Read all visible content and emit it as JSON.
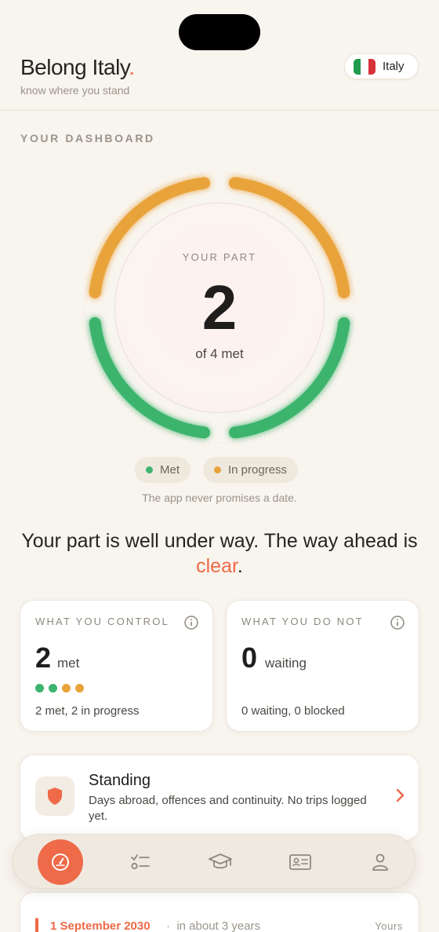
{
  "header": {
    "title": "Belong Italy",
    "title_dot": ".",
    "tagline": "know where you stand",
    "country": "Italy"
  },
  "dashboard": {
    "section_label": "YOUR DASHBOARD",
    "dial_caption": "YOUR PART",
    "met_count": "2",
    "met_of": "of 4 met",
    "segments": [
      {
        "status": "in_progress"
      },
      {
        "status": "in_progress"
      },
      {
        "status": "met"
      },
      {
        "status": "met"
      }
    ],
    "legend": [
      {
        "label": "Met",
        "color": "#3db46d"
      },
      {
        "label": "In progress",
        "color": "#e9a33b"
      }
    ],
    "disclaimer": "The app never promises a date.",
    "headline_main": "Your part is well under way. The way ahead is ",
    "headline_accent": "clear",
    "headline_end": "."
  },
  "control_card": {
    "label": "WHAT YOU CONTROL",
    "value": "2",
    "unit": "met",
    "dots": [
      "#3db46d",
      "#3db46d",
      "#e9a33b",
      "#e9a33b"
    ],
    "footer": "2 met, 2 in progress"
  },
  "notcontrol_card": {
    "label": "WHAT YOU DO NOT",
    "value": "0",
    "unit": "waiting",
    "footer": "0 waiting, 0 blocked"
  },
  "standing": {
    "title": "Standing",
    "description": "Days abroad, offences and continuity. No trips logged yet."
  },
  "tabs": [
    {
      "name": "dashboard",
      "icon": "gauge-icon",
      "active": true
    },
    {
      "name": "checklist",
      "icon": "checklist-icon",
      "active": false
    },
    {
      "name": "learn",
      "icon": "graduation-cap-icon",
      "active": false
    },
    {
      "name": "documents",
      "icon": "id-card-icon",
      "active": false
    },
    {
      "name": "profile",
      "icon": "person-icon",
      "active": false
    }
  ],
  "milestone": {
    "date": "1 September 2030",
    "relative": "in about 3 years",
    "owner": "Yours"
  },
  "colors": {
    "accent": "#ee6a48",
    "met": "#3db46d",
    "in_progress": "#e9a33b"
  }
}
